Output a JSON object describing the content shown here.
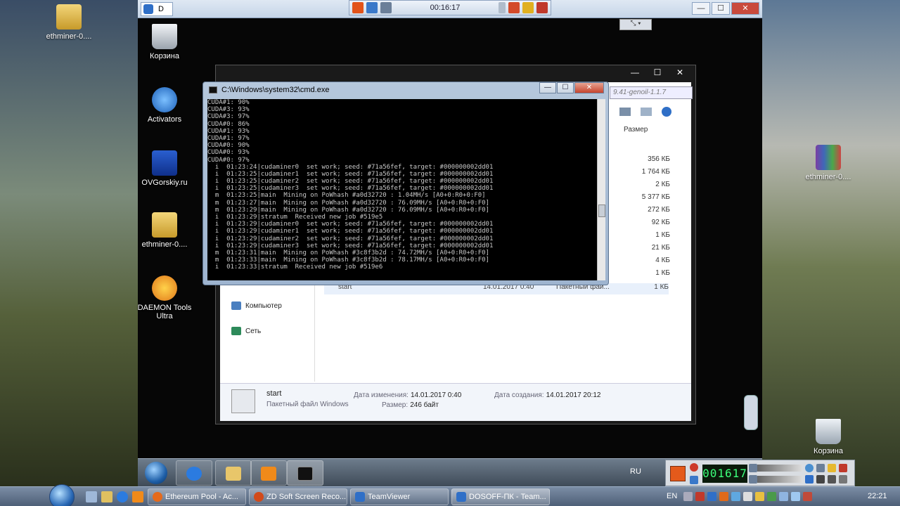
{
  "local_desktop": {
    "icons": [
      {
        "label": "ethminer-0...."
      },
      {
        "label": "ethminer-0...."
      },
      {
        "label": "Корзина"
      }
    ]
  },
  "remote_desktop": {
    "icons": [
      {
        "label": "Корзина"
      },
      {
        "label": "Activators"
      },
      {
        "label": "OVGorskiy.ru"
      },
      {
        "label": "ethminer-0...."
      },
      {
        "label": "DAEMON Tools Ultra"
      }
    ]
  },
  "teamviewer_bar": {
    "tab_label": "D",
    "minimize": "—",
    "maximize": "☐",
    "close": "✕",
    "mini_ctrl": "⤡ ▾"
  },
  "recorder_toolbar": {
    "timer": "00:16:17"
  },
  "explorer": {
    "path_fragment": "9.41-genoil-1.1.7",
    "column_size": "Размер",
    "sizes": [
      "356 КБ",
      "1 764 КБ",
      "2 КБ",
      "5 377 КБ",
      "272 КБ",
      "92 КБ",
      "1 КБ",
      "21 КБ",
      "4 КБ",
      "1 КБ",
      "1 КБ"
    ],
    "nav": [
      "Компьютер",
      "Сеть"
    ],
    "selected_row": {
      "name": "start",
      "date": "14.01.2017 0:40",
      "type": "Пакетный фай...",
      "size": "1 КБ"
    },
    "details": {
      "name": "start",
      "type": "Пакетный файл Windows",
      "modified_label": "Дата изменения:",
      "modified_value": "14.01.2017 0:40",
      "size_label": "Размер:",
      "size_value": "246 байт",
      "created_label": "Дата создания:",
      "created_value": "14.01.2017 20:12"
    }
  },
  "cmd": {
    "title": "C:\\Windows\\system32\\cmd.exe",
    "lines": [
      "CUDA#1: 90%",
      "CUDA#3: 93%",
      "CUDA#3: 97%",
      "CUDA#0: 86%",
      "CUDA#1: 93%",
      "CUDA#1: 97%",
      "CUDA#0: 90%",
      "CUDA#0: 93%",
      "CUDA#0: 97%",
      "  i  01:23:24|cudaminer0  set work; seed: #71a56fef, target: #000000002dd01",
      "  i  01:23:25|cudaminer1  set work; seed: #71a56fef, target: #000000002dd01",
      "  i  01:23:25|cudaminer2  set work; seed: #71a56fef, target: #000000002dd01",
      "  i  01:23:25|cudaminer3  set work; seed: #71a56fef, target: #000000002dd01",
      "  m  01:23:25|main  Mining on PoWhash #a0d32720 : 1.04MH/s [A0+0:R0+0:F0]",
      "  m  01:23:27|main  Mining on PoWhash #a0d32720 : 76.09MH/s [A0+0:R0+0:F0]",
      "  m  01:23:29|main  Mining on PoWhash #a0d32720 : 76.09MH/s [A0+0:R0+0:F0]",
      "  i  01:23:29|stratum  Received new job #519e5",
      "  i  01:23:29|cudaminer0  set work; seed: #71a56fef, target: #000000002dd01",
      "  i  01:23:29|cudaminer1  set work; seed: #71a56fef, target: #000000002dd01",
      "  i  01:23:29|cudaminer2  set work; seed: #71a56fef, target: #000000002dd01",
      "  i  01:23:29|cudaminer3  set work; seed: #71a56fef, target: #000000002dd01",
      "  m  01:23:31|main  Mining on PoWhash #3c8f3b2d : 74.72MH/s [A0+0:R0+0:F0]",
      "  m  01:23:33|main  Mining on PoWhash #3c8f3b2d : 78.17MH/s [A0+0:R0+0:F0]",
      "  i  01:23:33|stratum  Received new job #519e6"
    ]
  },
  "remote_taskbar": {
    "lang": "RU"
  },
  "recorder_widget": {
    "digits": "001617"
  },
  "local_taskbar": {
    "tasks": [
      "Ethereum Pool - Ac...",
      "ZD Soft Screen Reco...",
      "TeamViewer",
      "DOSOFF-ПК - Team..."
    ],
    "lang": "EN",
    "clock": "22:21"
  }
}
